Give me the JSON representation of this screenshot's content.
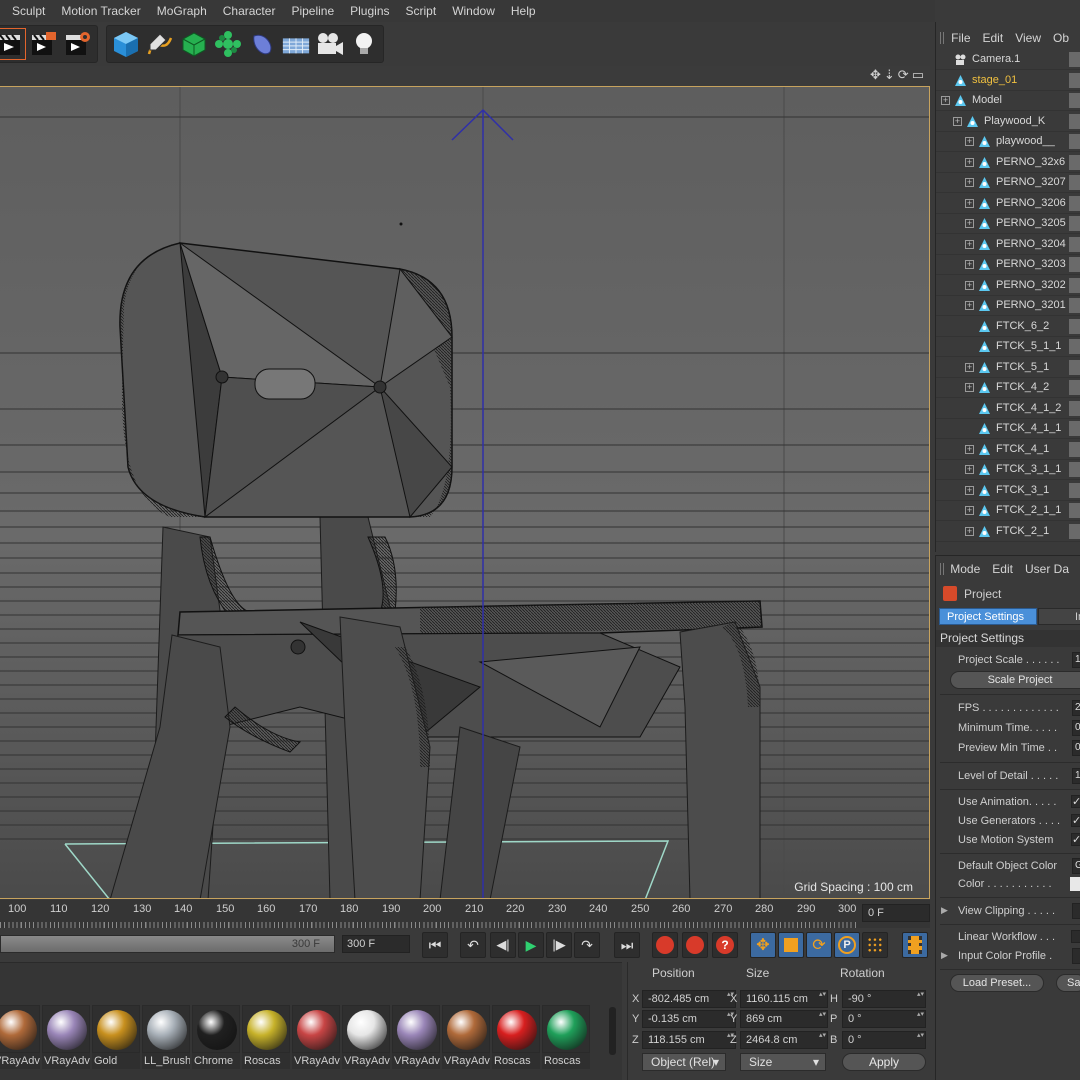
{
  "menu": [
    "Sculpt",
    "Motion Tracker",
    "MoGraph",
    "Character",
    "Pipeline",
    "Plugins",
    "Script",
    "Window",
    "Help"
  ],
  "toolbar_icons": [
    "render-region-icon",
    "render-to-picture-viewer-icon",
    "render-settings-icon",
    "cube-primitive-icon",
    "pen-spline-icon",
    "subdivision-generator-icon",
    "cloner-icon",
    "deformer-icon",
    "floor-icon",
    "camera-icon",
    "light-bulb-icon"
  ],
  "viewport": {
    "grid_spacing": "Grid Spacing : 100 cm"
  },
  "timeline": {
    "ticks": [
      "100",
      "110",
      "120",
      "130",
      "140",
      "150",
      "160",
      "170",
      "180",
      "190",
      "200",
      "210",
      "220",
      "230",
      "240",
      "250",
      "260",
      "270",
      "280",
      "290",
      "300"
    ],
    "current_frame": "0 F",
    "range_end": "300 F",
    "end_frame": "300 F"
  },
  "materials": [
    {
      "name": "VRayAdv",
      "color": "#b06a3a"
    },
    {
      "name": "VRayAdv",
      "color": "#9a86b8"
    },
    {
      "name": "Gold",
      "color": "#c8901e"
    },
    {
      "name": "LL_Brush",
      "color": "#a8b0b8"
    },
    {
      "name": "Chrome",
      "color": "#202020"
    },
    {
      "name": "Roscas",
      "color": "#c7b22a"
    },
    {
      "name": "VRayAdv",
      "color": "#c84545"
    },
    {
      "name": "VRayAdv",
      "color": "#e6e6e6"
    },
    {
      "name": "VRayAdv",
      "color": "#9a86b8"
    },
    {
      "name": "VRayAdv",
      "color": "#b06a3a"
    },
    {
      "name": "Roscas",
      "color": "#d81f1f"
    },
    {
      "name": "Roscas",
      "color": "#1fa05a"
    }
  ],
  "coords": {
    "headers": {
      "position": "Position",
      "size": "Size",
      "rotation": "Rotation"
    },
    "rows": [
      {
        "axis": "X",
        "position": "-802.485 cm",
        "size_axis": "X",
        "size": "1160.115 cm",
        "rot_axis": "H",
        "rotation": "-90 °"
      },
      {
        "axis": "Y",
        "position": "-0.135 cm",
        "size_axis": "Y",
        "size": "869 cm",
        "rot_axis": "P",
        "rotation": "0 °"
      },
      {
        "axis": "Z",
        "position": "118.155 cm",
        "size_axis": "Z",
        "size": "2464.8 cm",
        "rot_axis": "B",
        "rotation": "0 °"
      }
    ],
    "mode_dropdown": "Object (Rel)",
    "size_dropdown": "Size",
    "apply": "Apply"
  },
  "object_manager": {
    "menu": [
      "File",
      "Edit",
      "View",
      "Ob"
    ],
    "objects": [
      {
        "name": "Camera.1",
        "indent": 0,
        "icon": "camera",
        "expand": false,
        "highlight": false
      },
      {
        "name": "stage_01",
        "indent": 0,
        "icon": "null",
        "expand": false,
        "highlight": true
      },
      {
        "name": "Model",
        "indent": 0,
        "icon": "null",
        "expand": true,
        "highlight": false
      },
      {
        "name": "Playwood_K",
        "indent": 1,
        "icon": "null",
        "expand": true,
        "highlight": false
      },
      {
        "name": "playwood__",
        "indent": 2,
        "icon": "null",
        "expand": true,
        "highlight": false
      },
      {
        "name": "PERNO_32x6",
        "indent": 2,
        "icon": "null",
        "expand": true,
        "highlight": false
      },
      {
        "name": "PERNO_3207",
        "indent": 2,
        "icon": "null",
        "expand": true,
        "highlight": false
      },
      {
        "name": "PERNO_3206",
        "indent": 2,
        "icon": "null",
        "expand": true,
        "highlight": false
      },
      {
        "name": "PERNO_3205",
        "indent": 2,
        "icon": "null",
        "expand": true,
        "highlight": false
      },
      {
        "name": "PERNO_3204",
        "indent": 2,
        "icon": "null",
        "expand": true,
        "highlight": false
      },
      {
        "name": "PERNO_3203",
        "indent": 2,
        "icon": "null",
        "expand": true,
        "highlight": false
      },
      {
        "name": "PERNO_3202",
        "indent": 2,
        "icon": "null",
        "expand": true,
        "highlight": false
      },
      {
        "name": "PERNO_3201",
        "indent": 2,
        "icon": "null",
        "expand": true,
        "highlight": false
      },
      {
        "name": "FTCK_6_2",
        "indent": 2,
        "icon": "null",
        "expand": false,
        "highlight": false
      },
      {
        "name": "FTCK_5_1_1",
        "indent": 2,
        "icon": "null",
        "expand": false,
        "highlight": false
      },
      {
        "name": "FTCK_5_1",
        "indent": 2,
        "icon": "null",
        "expand": true,
        "highlight": false
      },
      {
        "name": "FTCK_4_2",
        "indent": 2,
        "icon": "null",
        "expand": true,
        "highlight": false
      },
      {
        "name": "FTCK_4_1_2",
        "indent": 2,
        "icon": "null",
        "expand": false,
        "highlight": false
      },
      {
        "name": "FTCK_4_1_1",
        "indent": 2,
        "icon": "null",
        "expand": false,
        "highlight": false
      },
      {
        "name": "FTCK_4_1",
        "indent": 2,
        "icon": "null",
        "expand": true,
        "highlight": false
      },
      {
        "name": "FTCK_3_1_1",
        "indent": 2,
        "icon": "null",
        "expand": true,
        "highlight": false
      },
      {
        "name": "FTCK_3_1",
        "indent": 2,
        "icon": "null",
        "expand": true,
        "highlight": false
      },
      {
        "name": "FTCK_2_1_1",
        "indent": 2,
        "icon": "null",
        "expand": true,
        "highlight": false
      },
      {
        "name": "FTCK_2_1",
        "indent": 2,
        "icon": "null",
        "expand": true,
        "highlight": false
      }
    ]
  },
  "attributes": {
    "menu": [
      "Mode",
      "Edit",
      "User Da"
    ],
    "object_name": "Project",
    "tabs": [
      "Project Settings",
      "In"
    ],
    "section": "Project Settings",
    "fields": {
      "project_scale": {
        "label": "Project Scale . . . . . .",
        "value": "1"
      },
      "scale_project": "Scale Project",
      "fps": {
        "label": "FPS . . . . . . . . . . . . .",
        "value": "2"
      },
      "min_time": {
        "label": "Minimum Time. . . . .",
        "value": "0"
      },
      "preview_min": {
        "label": "Preview Min Time . .",
        "value": "0"
      },
      "lod": {
        "label": "Level of Detail . . . . .",
        "value": "1"
      },
      "use_animation": {
        "label": "Use Animation. . . . .",
        "checked": "✓"
      },
      "use_generators": {
        "label": "Use Generators . . . .",
        "checked": "✓"
      },
      "use_motion": {
        "label": "Use Motion System",
        "checked": "✓"
      },
      "default_color": {
        "label": "Default Object Color",
        "value": "G"
      },
      "color": {
        "label": "Color . . . . . . . . . . ."
      },
      "view_clipping": {
        "label": "View Clipping . . . . ."
      },
      "linear_workflow": {
        "label": "Linear Workflow . . ."
      },
      "input_color": {
        "label": "Input Color Profile ."
      }
    },
    "load_preset": "Load Preset...",
    "save_preset": "Sa"
  },
  "colors": {
    "accent": "#e3652d",
    "selection": "#4a90d9",
    "highlight_text": "#f0c040"
  }
}
